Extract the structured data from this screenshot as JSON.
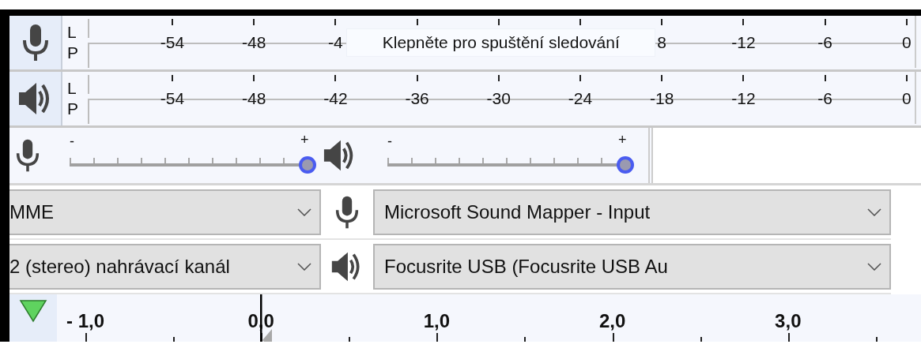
{
  "meters": [
    {
      "kind": "record",
      "channels": [
        "L",
        "P"
      ],
      "ticks": [
        {
          "kind": "label",
          "label": "-54"
        },
        {
          "kind": "label",
          "label": "-48"
        },
        {
          "kind": "label",
          "label": "-4"
        },
        {
          "kind": "tooltip",
          "label": "Klepněte pro spuštění sledování"
        },
        {
          "kind": "label",
          "label": "8"
        },
        {
          "kind": "label",
          "label": "-12"
        },
        {
          "kind": "label",
          "label": "-6"
        },
        {
          "kind": "label",
          "label": "0"
        }
      ]
    },
    {
      "kind": "playback",
      "channels": [
        "L",
        "P"
      ],
      "ticks": [
        {
          "kind": "label",
          "label": "-54"
        },
        {
          "kind": "label",
          "label": "-48"
        },
        {
          "kind": "label",
          "label": "-42"
        },
        {
          "kind": "label",
          "label": "-36"
        },
        {
          "kind": "label",
          "label": "-30"
        },
        {
          "kind": "label",
          "label": "-24"
        },
        {
          "kind": "label",
          "label": "-18"
        },
        {
          "kind": "label",
          "label": "-12"
        },
        {
          "kind": "label",
          "label": "-6"
        },
        {
          "kind": "label",
          "label": "0"
        }
      ]
    }
  ],
  "sliders": [
    {
      "kind": "record",
      "min_label": "-",
      "max_label": "+",
      "level": 1
    },
    {
      "kind": "playback",
      "min_label": "-",
      "max_label": "+",
      "level": 1
    }
  ],
  "device_rows": [
    {
      "first": {
        "value": "MME"
      },
      "kind": "record",
      "device": {
        "value": "Microsoft Sound Mapper - Input"
      }
    },
    {
      "first": {
        "value": "2 (stereo) nahrávací kanál"
      },
      "kind": "playback",
      "device": {
        "value": "Focusrite USB (Focusrite USB Au"
      }
    }
  ],
  "timeline": {
    "labels": [
      "- 1,0",
      "0,0",
      "1,0",
      "2,0",
      "3,0"
    ]
  }
}
